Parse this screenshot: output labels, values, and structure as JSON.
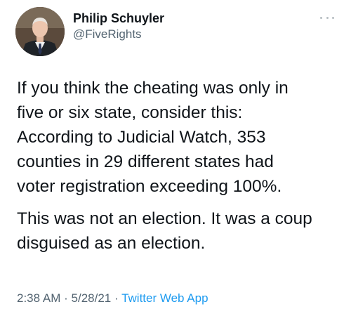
{
  "author": {
    "display_name": "Philip Schuyler",
    "handle": "@FiveRights",
    "avatar_icon": "profile-photo"
  },
  "menu_icon": "more-options-icon",
  "tweet": {
    "paragraph_1_lines": [
      "If you think the cheating was only in",
      "five or six state, consider this:",
      "According to Judicial Watch, 353",
      "counties in 29 different states had",
      "voter registration exceeding 100%."
    ],
    "paragraph_2_lines": [
      "This was not an election. It was a coup",
      "disguised as an election."
    ]
  },
  "meta": {
    "time": "2:38 AM",
    "separator_1": "·",
    "date": "5/28/21",
    "separator_2": "·",
    "source": "Twitter Web App"
  },
  "colors": {
    "text": "#0f1419",
    "secondary": "#536471",
    "link": "#1d9bf0"
  }
}
